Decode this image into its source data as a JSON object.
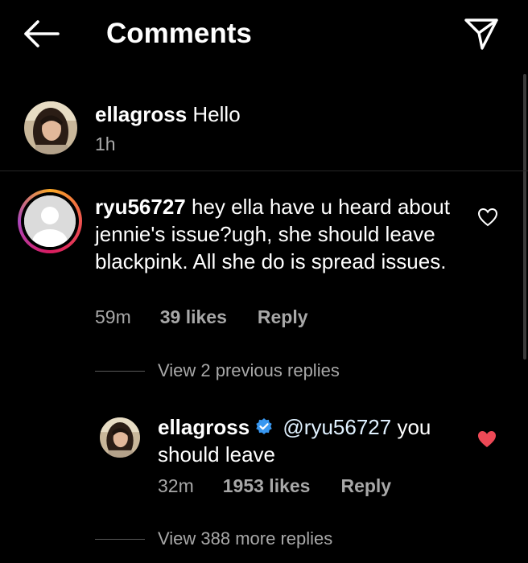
{
  "header": {
    "title": "Comments",
    "back_icon": "arrow-left-icon",
    "send_icon": "send-icon"
  },
  "comments": [
    {
      "username": "ellagross",
      "text": "Hello",
      "time": "1h"
    },
    {
      "username": "ryu56727",
      "text": "hey ella have u heard about jennie's issue?ugh, she should leave blackpink. All she do is spread issues.",
      "time": "59m",
      "likes": "39 likes",
      "reply_label": "Reply",
      "liked": false,
      "view_previous": "View 2 previous replies",
      "replies": [
        {
          "username": "ellagross",
          "verified": true,
          "mention": "@ryu56727",
          "text": "you should leave",
          "time": "32m",
          "likes": "1953 likes",
          "reply_label": "Reply",
          "liked": true
        }
      ],
      "view_more": "View 388 more replies"
    }
  ],
  "colors": {
    "background": "#000000",
    "text": "#ffffff",
    "muted": "#a8a8a8",
    "like": "#ed4956",
    "verified": "#3897f0"
  }
}
